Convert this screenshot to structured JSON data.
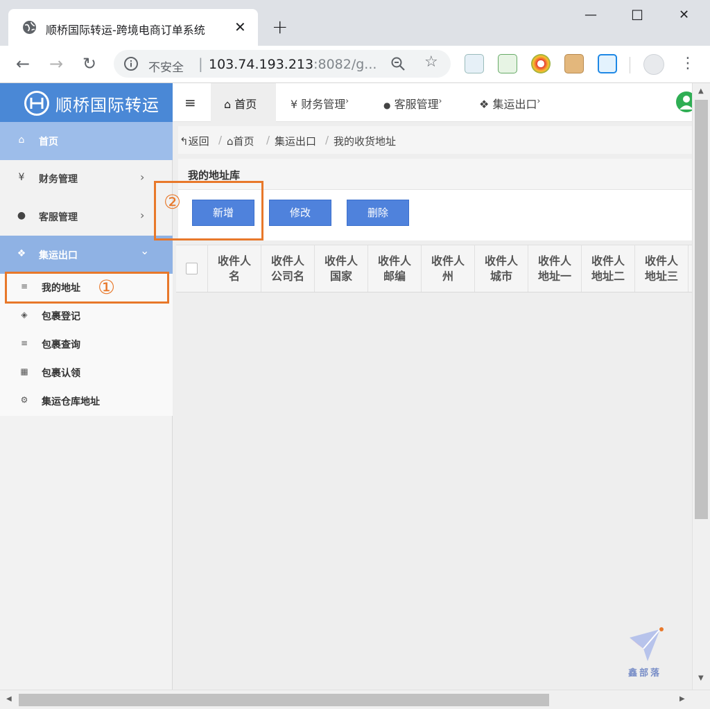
{
  "browser": {
    "tab_title": "顺桥国际转运-跨境电商订单系统",
    "tab_close": "✕",
    "new_tab": "+",
    "minimize": "—",
    "maximize": "☐",
    "close": "✕",
    "back": "←",
    "forward": "→",
    "reload": "↻",
    "security_label": "不安全",
    "url_host": "103.74.193.213",
    "url_rest": ":8082/g...",
    "star": "☆",
    "menu": "⋮"
  },
  "brand": {
    "name": "顺桥国际转运",
    "color": "#4a88d6"
  },
  "sidebar": {
    "home": {
      "icon": "home-icon",
      "glyph": "⌂",
      "label": "首页"
    },
    "items": [
      {
        "icon": "yen-icon",
        "glyph": "¥",
        "label": "财务管理",
        "arrow": "›"
      },
      {
        "icon": "user-icon",
        "glyph": "●",
        "label": "客服管理",
        "arrow": "›"
      }
    ],
    "group": {
      "icon": "cubes-icon",
      "glyph": "❖",
      "label": "集运出口",
      "arrow": "⌄"
    },
    "subitems": [
      {
        "icon": "list-icon",
        "glyph": "≡",
        "label": "我的地址"
      },
      {
        "icon": "cube-icon",
        "glyph": "◈",
        "label": "包裹登记"
      },
      {
        "icon": "list-icon",
        "glyph": "≡",
        "label": "包裹查询"
      },
      {
        "icon": "grid-icon",
        "glyph": "▦",
        "label": "包裹认领"
      },
      {
        "icon": "gear-icon",
        "glyph": "⚙",
        "label": "集运仓库地址"
      }
    ]
  },
  "annotations": {
    "first": "①",
    "second": "②",
    "color": "#e8782a"
  },
  "topnav": {
    "hamburger": "≡",
    "items": [
      {
        "glyph": "⌂",
        "label": "首页",
        "arrow": ""
      },
      {
        "glyph": "¥",
        "label": "财务管理",
        "arrow": "›"
      },
      {
        "glyph": "●",
        "label": "客服管理",
        "arrow": "›"
      },
      {
        "glyph": "❖",
        "label": "集运出口",
        "arrow": "›"
      }
    ]
  },
  "breadcrumb": {
    "back": "↰返回",
    "home": "⌂首页",
    "level2": "集运出口",
    "current": "我的收货地址",
    "sep": "/"
  },
  "panel": {
    "title": "我的地址库",
    "buttons": {
      "add": "新增",
      "edit": "修改",
      "delete": "删除"
    },
    "button_color": "#4f82dc"
  },
  "table": {
    "columns": [
      [
        "收件人",
        "名"
      ],
      [
        "收件人",
        "公司名"
      ],
      [
        "收件人",
        "国家"
      ],
      [
        "收件人",
        "邮编"
      ],
      [
        "收件人",
        "州"
      ],
      [
        "收件人",
        "城市"
      ],
      [
        "收件人",
        "地址一"
      ],
      [
        "收件人",
        "地址二"
      ],
      [
        "收件人",
        "地址三"
      ]
    ]
  },
  "watermark": {
    "text": "鑫部落"
  }
}
